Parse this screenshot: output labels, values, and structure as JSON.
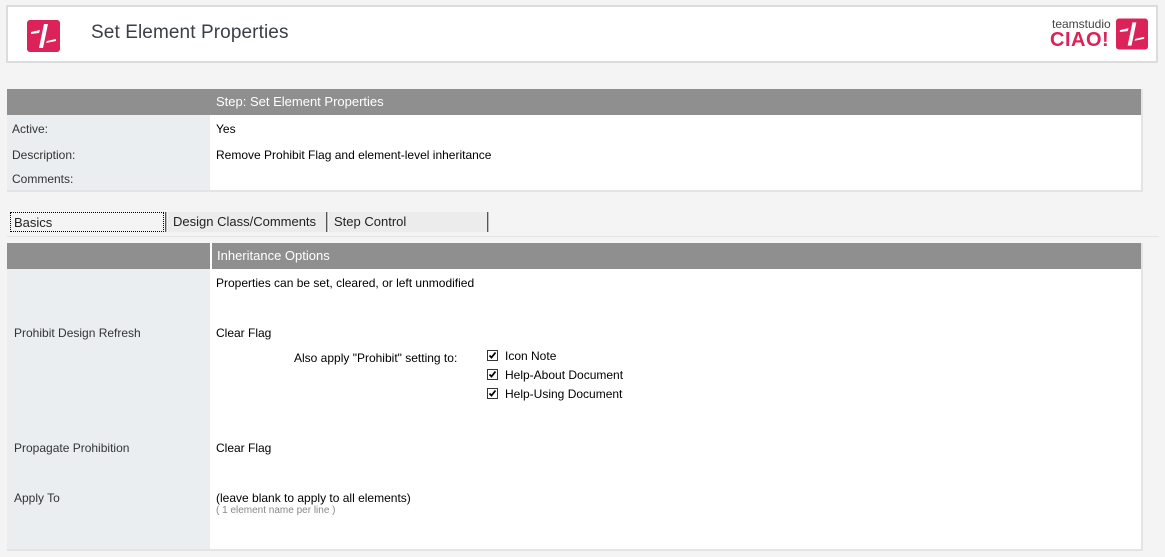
{
  "header": {
    "title": "Set Element Properties",
    "brand_small": "teamstudio",
    "brand_big": "CIAO!",
    "brand_color": "#dc2359"
  },
  "step_panel": {
    "title": "Step:  Set Element Properties",
    "rows": [
      {
        "label": "Active:",
        "value": "Yes"
      },
      {
        "label": "Description:",
        "value": "Remove Prohibit Flag and element-level inheritance"
      },
      {
        "label": "Comments:",
        "value": ""
      }
    ]
  },
  "tabs": [
    {
      "label": "Basics",
      "active": true
    },
    {
      "label": "Design Class/Comments",
      "active": false
    },
    {
      "label": "Step Control",
      "active": false
    }
  ],
  "options_panel": {
    "title": "Inheritance Options",
    "intro": "Properties can be set, cleared, or left unmodified",
    "prohibit_design_refresh": {
      "label": "Prohibit Design Refresh",
      "value": "Clear Flag",
      "also_apply_label": "Also apply \"Prohibit\" setting to:",
      "checkboxes": [
        {
          "label": "Icon Note",
          "checked": true
        },
        {
          "label": "Help-About Document",
          "checked": true
        },
        {
          "label": "Help-Using Document",
          "checked": true
        }
      ]
    },
    "propagate_prohibition": {
      "label": "Propagate Prohibition",
      "value": "Clear Flag"
    },
    "apply_to": {
      "label": "Apply To",
      "value": "(leave blank to apply to all elements)",
      "hint": "( 1 element name per line )"
    }
  }
}
